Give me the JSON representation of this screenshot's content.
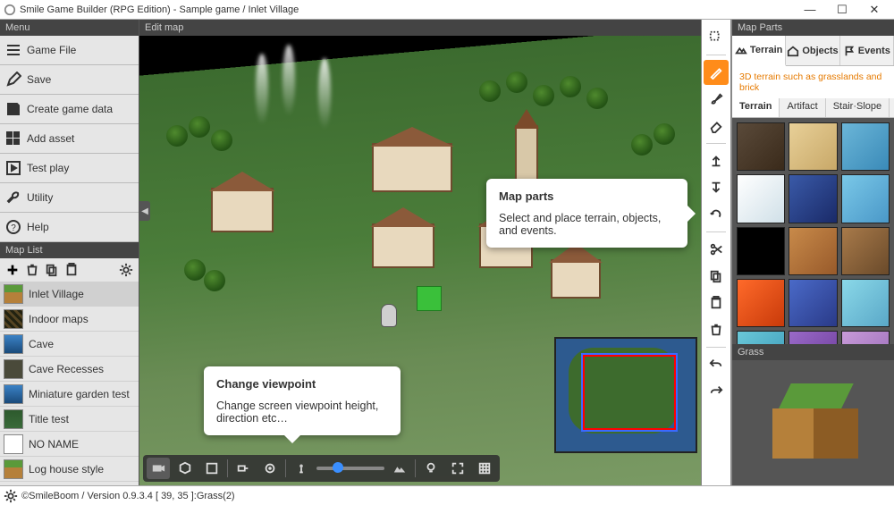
{
  "window": {
    "title": "Smile Game Builder (RPG Edition) - Sample game / Inlet Village"
  },
  "menu": {
    "header": "Menu",
    "items": [
      {
        "label": "Game File"
      },
      {
        "label": "Save"
      },
      {
        "label": "Create game data"
      },
      {
        "label": "Add asset"
      },
      {
        "label": "Test play"
      },
      {
        "label": "Utility"
      },
      {
        "label": "Help"
      }
    ]
  },
  "maplist": {
    "header": "Map List",
    "items": [
      {
        "label": "Inlet Village",
        "thumb": "th-grass",
        "selected": true
      },
      {
        "label": "Indoor maps",
        "thumb": "th-dark"
      },
      {
        "label": "Cave",
        "thumb": "th-water"
      },
      {
        "label": "Cave Recesses",
        "thumb": "th-rock"
      },
      {
        "label": "Miniature garden test",
        "thumb": "th-water"
      },
      {
        "label": "Title test",
        "thumb": "th-forest"
      },
      {
        "label": "NO NAME",
        "thumb": "th-white"
      },
      {
        "label": "Log house style",
        "thumb": "th-grass"
      }
    ]
  },
  "editmap": {
    "header": "Edit map"
  },
  "mapparts": {
    "header": "Map Parts",
    "tabs": [
      {
        "label": "Terrain"
      },
      {
        "label": "Objects"
      },
      {
        "label": "Events"
      }
    ],
    "description": "3D terrain such as grasslands and brick",
    "subtabs": [
      {
        "label": "Terrain"
      },
      {
        "label": "Artifact"
      },
      {
        "label": "Stair·Slope"
      }
    ],
    "preview_label": "Grass"
  },
  "callouts": {
    "mapparts": {
      "title": "Map parts",
      "body": "Select and place terrain, objects, and events."
    },
    "viewpoint": {
      "title": "Change viewpoint",
      "body": "Change screen viewpoint height, direction etc…"
    }
  },
  "status": {
    "text": "©SmileBoom / Version 0.9.3.4  [ 39, 35 ]:Grass(2)"
  }
}
